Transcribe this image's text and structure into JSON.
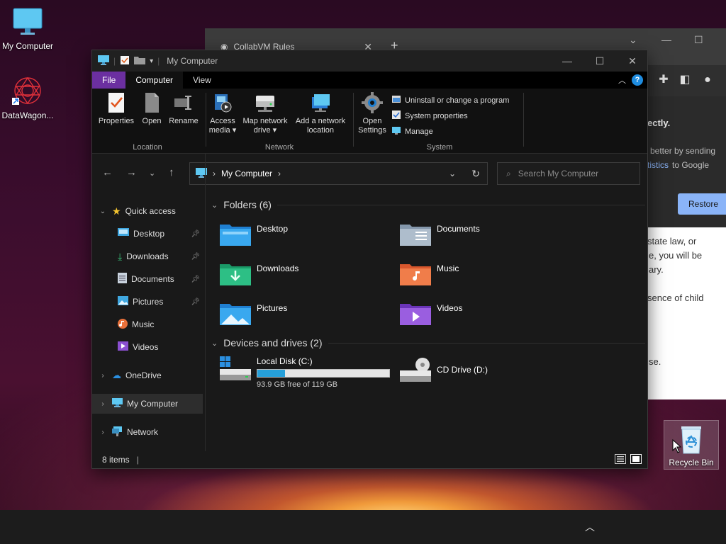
{
  "desktop": {
    "icons": [
      {
        "label": "My Computer"
      },
      {
        "label": "DataWagon..."
      },
      {
        "label": "Recycle Bin"
      }
    ]
  },
  "browser": {
    "tab_title": "CollabVM Rules",
    "new_tab": "+",
    "text_fragments": [
      "ectly.",
      "better by sending",
      "tistics",
      "to Google",
      "state law, or",
      "e, you will be",
      "ary.",
      "sence of child",
      "se."
    ],
    "restore_button": "Restore"
  },
  "explorer": {
    "title": "My Computer",
    "ribbon_tabs": [
      "File",
      "Computer",
      "View"
    ],
    "active_tab": "Computer",
    "groups": {
      "location": {
        "name": "Location",
        "buttons": [
          "Properties",
          "Open",
          "Rename"
        ]
      },
      "network": {
        "name": "Network",
        "buttons": [
          {
            "line1": "Access",
            "line2": "media ▾"
          },
          {
            "line1": "Map network",
            "line2": "drive ▾"
          },
          {
            "line1": "Add a network",
            "line2": "location"
          }
        ]
      },
      "system": {
        "name": "System",
        "open_settings": {
          "line1": "Open",
          "line2": "Settings"
        },
        "small": [
          "Uninstall or change a program",
          "System properties",
          "Manage"
        ]
      }
    },
    "address": {
      "path": "My Computer"
    },
    "search": {
      "placeholder": "Search My Computer"
    },
    "sidebar": {
      "quick_access": "Quick access",
      "items": [
        "Desktop",
        "Downloads",
        "Documents",
        "Pictures",
        "Music",
        "Videos"
      ],
      "onedrive": "OneDrive",
      "my_computer": "My Computer",
      "network": "Network"
    },
    "folders_header": "Folders (6)",
    "folders": [
      "Desktop",
      "Documents",
      "Downloads",
      "Music",
      "Pictures",
      "Videos"
    ],
    "drives_header": "Devices and drives (2)",
    "drives": [
      {
        "name": "Local Disk (C:)",
        "free": "93.9 GB free of 119 GB",
        "used_fraction": 0.21
      },
      {
        "name": "CD Drive (D:)"
      }
    ],
    "status": {
      "items": "8 items"
    }
  },
  "colors": {
    "accent_file_tab": "#6b2fa0",
    "drive_bar": "#26a0da",
    "restore_button": "#8ab4f8"
  }
}
